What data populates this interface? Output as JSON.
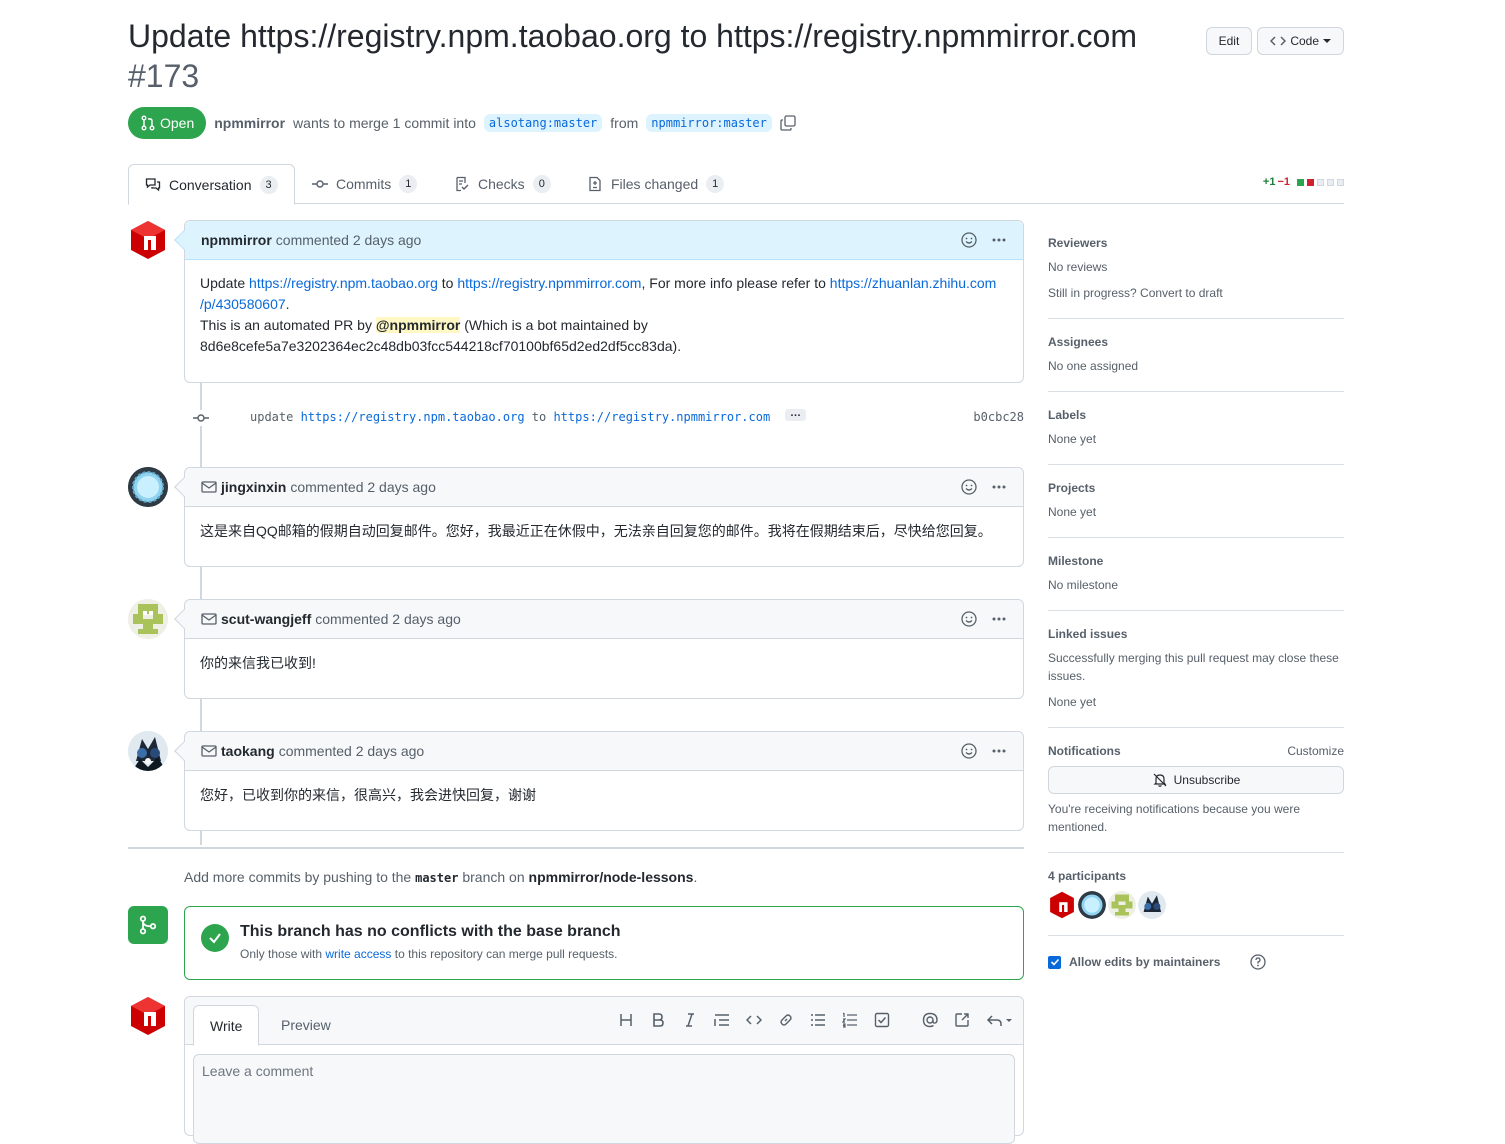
{
  "pr": {
    "title": "Update https://registry.npm.taobao.org to https://registry.npmmirror.com",
    "number": "#173",
    "state": "Open",
    "author": "npmmirror",
    "merge_text_1": "wants to merge 1 commit into",
    "base_branch": "alsotang:master",
    "from_text": "from",
    "head_branch": "npmmirror:master"
  },
  "header": {
    "edit_label": "Edit",
    "code_label": "Code"
  },
  "tabs": [
    {
      "label": "Conversation",
      "count": "3"
    },
    {
      "label": "Commits",
      "count": "1"
    },
    {
      "label": "Checks",
      "count": "0"
    },
    {
      "label": "Files changed",
      "count": "1"
    }
  ],
  "diffstat": {
    "added": "+1",
    "removed": "−1"
  },
  "comments": [
    {
      "author": "npmmirror",
      "meta": "commented 2 days ago",
      "body": {
        "t1": "Update ",
        "l1": "https://registry.npm.taobao.org",
        "t2": " to ",
        "l2": "https://registry.npmmirror.com",
        "t3": ", For more info please refer to ",
        "l3a": "https://zhuanlan.zhihu.com",
        "l3b": "/p/430580607",
        "t4": ".",
        "t5": "This is an automated PR by ",
        "mention": "@npmmirror",
        "t6": " (Which is a bot maintained by",
        "t7": "8d6e8cefe5a7e3202364ec2c48db03fcc544218cf70100bf65d2ed2df5cc83da)."
      }
    },
    {
      "author": "jingxinxin",
      "meta": "commented 2 days ago",
      "body": "这是来自QQ邮箱的假期自动回复邮件。您好，我最近正在休假中，无法亲自回复您的邮件。我将在假期结束后，尽快给您回复。"
    },
    {
      "author": "scut-wangjeff",
      "meta": "commented 2 days ago",
      "body": "你的来信我已收到!"
    },
    {
      "author": "taokang",
      "meta": "commented 2 days ago",
      "body": "您好，已收到你的来信，很高兴，我会进快回复，谢谢"
    }
  ],
  "commit": {
    "msg_1": "update ",
    "link_1": "https://registry.npm.taobao.org",
    "msg_2": " to ",
    "link_2": "https://registry.npmmirror.com",
    "ellipsis": "…",
    "sha": "b0cbc28"
  },
  "push_note": {
    "t1": "Add more commits by pushing to the ",
    "branch": "master",
    "t2": " branch on ",
    "repo": "npmmirror/node-lessons",
    "t3": "."
  },
  "merge": {
    "title": "This branch has no conflicts with the base branch",
    "sub_1": "Only those with ",
    "sub_link": "write access",
    "sub_2": " to this repository can merge pull requests."
  },
  "editor": {
    "write_tab": "Write",
    "preview_tab": "Preview",
    "placeholder": "Leave a comment"
  },
  "sidebar": {
    "reviewers": {
      "title": "Reviewers",
      "value": "No reviews",
      "draft": "Still in progress? Convert to draft"
    },
    "assignees": {
      "title": "Assignees",
      "value": "No one assigned"
    },
    "labels": {
      "title": "Labels",
      "value": "None yet"
    },
    "projects": {
      "title": "Projects",
      "value": "None yet"
    },
    "milestone": {
      "title": "Milestone",
      "value": "No milestone"
    },
    "linked": {
      "title": "Linked issues",
      "desc": "Successfully merging this pull request may close these issues.",
      "value": "None yet"
    },
    "notifications": {
      "title": "Notifications",
      "customize": "Customize",
      "unsubscribe": "Unsubscribe",
      "reason": "You're receiving notifications because you were mentioned."
    },
    "participants": {
      "title": "4 participants"
    },
    "allow_edits": "Allow edits by maintainers"
  },
  "colors": {
    "green": "#2da44e",
    "blue": "#0969da",
    "red": "#cf222e"
  }
}
